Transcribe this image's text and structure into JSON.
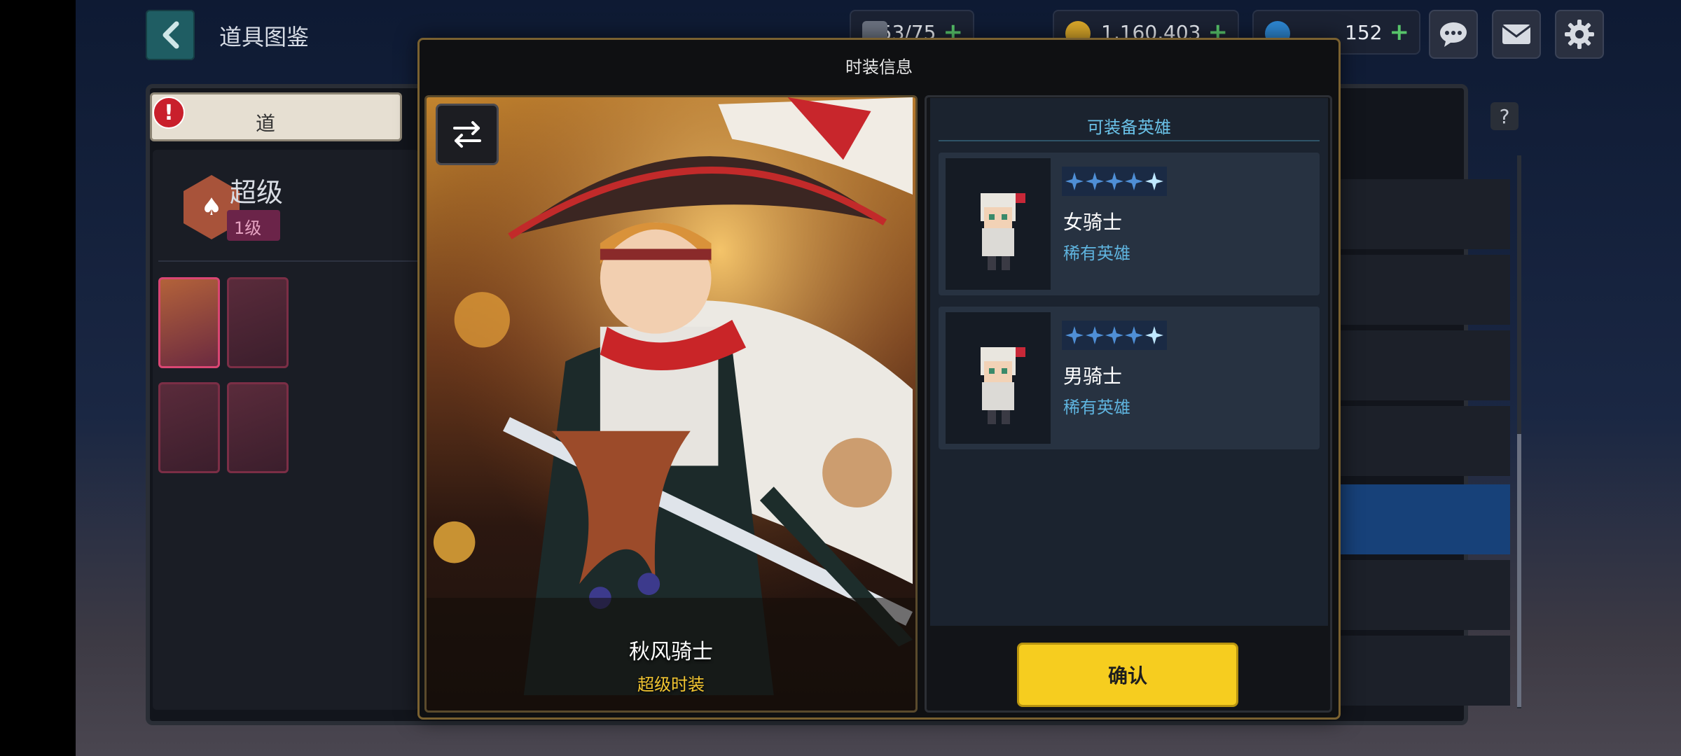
{
  "header": {
    "back_icon": "chevron-left-icon",
    "title": "道具图鉴"
  },
  "currencies": [
    {
      "icon": "stamina-icon",
      "value": "53/75",
      "color": "#a0a7b3"
    },
    {
      "icon": "gold-coin-icon",
      "value": "1,160,403",
      "color": "#e2b934"
    },
    {
      "icon": "gem-icon",
      "value": "152",
      "color": "#39a8f0"
    }
  ],
  "toolbar": {
    "chat_icon": "chat-icon",
    "mail_icon": "mail-icon",
    "settings_icon": "gear-icon"
  },
  "background_panel": {
    "tab_label": "道",
    "alert": "!",
    "item_name": "超级",
    "level_badge": "1级 ",
    "help": "?"
  },
  "modal": {
    "title": "时装信息",
    "swap_icon": "swap-icon",
    "costume": {
      "name": "秋风骑士",
      "grade": "超级时装"
    },
    "heroes_section_title": "可装备英雄",
    "heroes": [
      {
        "name": "女骑士",
        "rarity": "稀有英雄",
        "stars": 5
      },
      {
        "name": "男骑士",
        "rarity": "稀有英雄",
        "stars": 5
      }
    ],
    "confirm_label": "确认"
  },
  "colors": {
    "accent_gold": "#f6cd1f",
    "rarity_blue": "#5fb4df",
    "grade_yellow": "#f2c531"
  }
}
